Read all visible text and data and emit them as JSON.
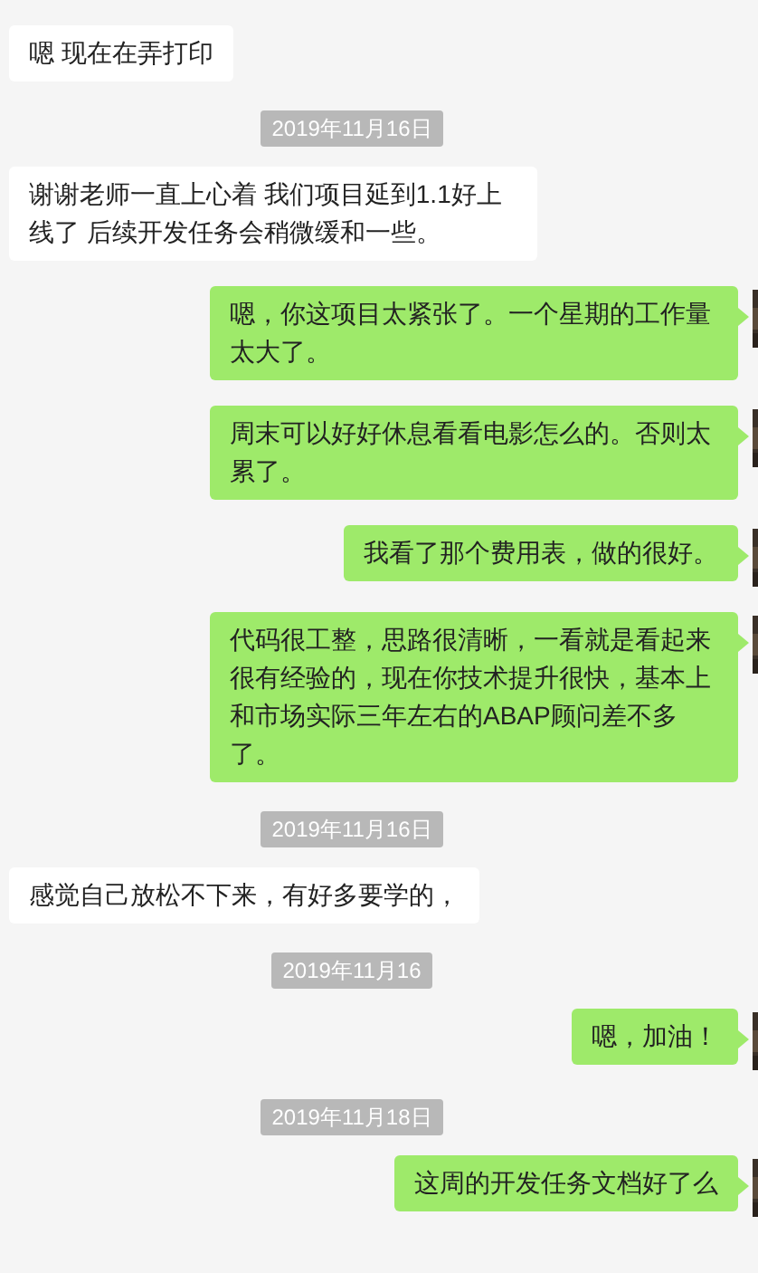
{
  "messages": [
    {
      "kind": "incoming",
      "text": "嗯  现在在弄打印"
    },
    {
      "kind": "date",
      "text": "2019年11月16日"
    },
    {
      "kind": "incoming",
      "text": "谢谢老师一直上心着  我们项目延到1.1好上线了  后续开发任务会稍微缓和一些。"
    },
    {
      "kind": "outgoing",
      "text": "嗯，你这项目太紧张了。一个星期的工作量太大了。"
    },
    {
      "kind": "outgoing",
      "text": "周末可以好好休息看看电影怎么的。否则太累了。"
    },
    {
      "kind": "outgoing",
      "text": "我看了那个费用表，做的很好。"
    },
    {
      "kind": "outgoing",
      "text": "代码很工整，思路很清晰，一看就是看起来很有经验的，现在你技术提升很快，基本上和市场实际三年左右的ABAP顾问差不多了。"
    },
    {
      "kind": "date",
      "text": "2019年11月16日"
    },
    {
      "kind": "incoming",
      "text": "感觉自己放松不下来，有好多要学的，"
    },
    {
      "kind": "date",
      "text": "2019年11月16"
    },
    {
      "kind": "outgoing",
      "text": "嗯，加油！"
    },
    {
      "kind": "date",
      "text": "2019年11月18日"
    },
    {
      "kind": "outgoing",
      "text": "这周的开发任务文档好了么"
    }
  ]
}
